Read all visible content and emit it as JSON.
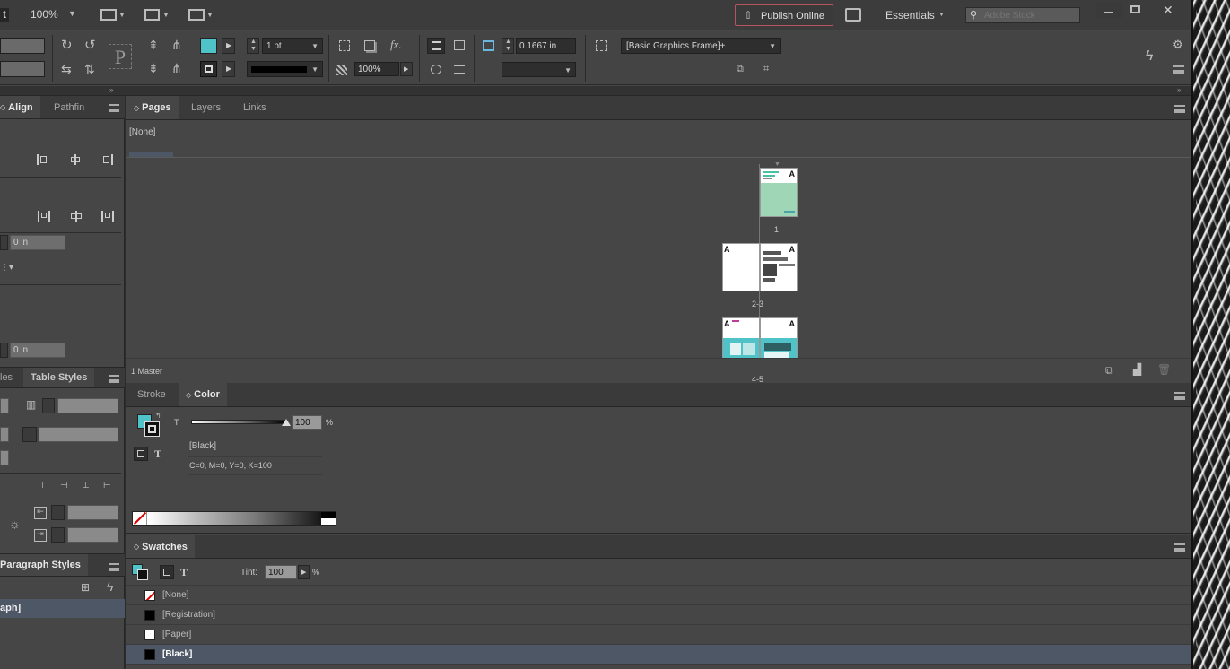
{
  "app_bar": {
    "doc_badge": "t",
    "zoom": "100%",
    "publish_label": "Publish Online",
    "workspace": "Essentials",
    "search_placeholder": "Adobe Stock"
  },
  "control_bar": {
    "stroke_weight": "1 pt",
    "dimension": "0.1667 in",
    "opacity": "100%",
    "frame_style": "[Basic Graphics Frame]+"
  },
  "left_panels": {
    "align_tabs": [
      "Align",
      "Pathfin"
    ],
    "offset_a": "0 in",
    "offset_b": "0 in",
    "styles_tabs": [
      "les",
      "Table Styles"
    ],
    "para_tab": "Paragraph Styles",
    "para_selected": "aph]"
  },
  "pages_panel": {
    "tabs": [
      "Pages",
      "Layers",
      "Links"
    ],
    "none_master": "[None]",
    "status": "1 Master",
    "page_labels": [
      "1",
      "2-3",
      "4-5"
    ],
    "master_marker": "A"
  },
  "color_panel": {
    "tabs": [
      "Stroke",
      "Color"
    ],
    "tint_label": "T",
    "tint_value": "100",
    "percent": "%",
    "color_name": "[Black]",
    "color_values": "C=0, M=0, Y=0, K=100",
    "text_glyph": "T"
  },
  "swatches_panel": {
    "tab": "Swatches",
    "tint_label": "Tint:",
    "tint_value": "100",
    "percent": "%",
    "text_glyph": "T",
    "items": [
      {
        "label": "[None]",
        "color": "none"
      },
      {
        "label": "[Registration]",
        "color": "#000000"
      },
      {
        "label": "[Paper]",
        "color": "#ffffff"
      },
      {
        "label": "[Black]",
        "color": "#000000"
      }
    ]
  },
  "colors": {
    "accent_teal": "#4fc3c7",
    "publish_border": "#b8545f",
    "selected_row": "#4d5766"
  }
}
